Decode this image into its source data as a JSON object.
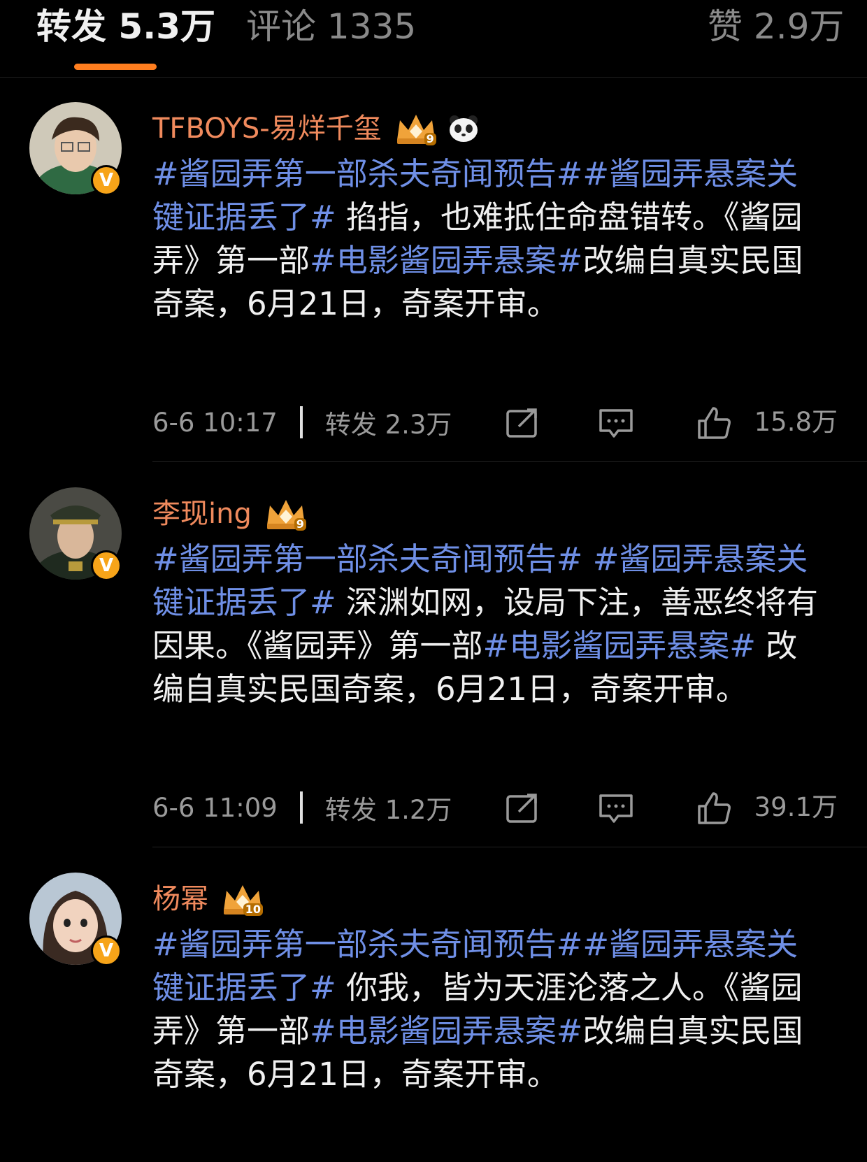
{
  "tabs": {
    "repost": "转发 5.3万",
    "comment": "评论 1335",
    "like": "赞 2.9万"
  },
  "colors": {
    "accent": "#ff7e1f",
    "username": "#f08a5d",
    "topic": "#6f8fe6",
    "badge": "#f7a419"
  },
  "posts": [
    {
      "user": "TFBOYS-易烊千玺",
      "level": "9",
      "verified_badge": "V",
      "topic1": "#酱园弄第一部杀夫奇闻预告##酱园弄悬案关键证据丢了#",
      "text1": " 掐指，也难抵住命盘错转。《酱园弄》第一部",
      "topic2": "#电影酱园弄悬案#",
      "text2": "改编自真实民国奇案，6月21日，奇案开审。",
      "time": "6-6 10:17",
      "repost": "转发 2.3万",
      "likes": "15.8万"
    },
    {
      "user": "李现ing",
      "level": "9",
      "verified_badge": "V",
      "topic1": "#酱园弄第一部杀夫奇闻预告# #酱园弄悬案关键证据丢了#",
      "text1": " 深渊如网，设局下注，善恶终将有因果。《酱园弄》第一部",
      "topic2": "#电影酱园弄悬案#",
      "text2": " 改编自真实民国奇案，6月21日，奇案开审。",
      "time": "6-6 11:09",
      "repost": "转发 1.2万",
      "likes": "39.1万"
    },
    {
      "user": "杨幂",
      "level": "10",
      "verified_badge": "V",
      "topic1": "#酱园弄第一部杀夫奇闻预告##酱园弄悬案关键证据丢了#",
      "text1": " 你我，皆为天涯沦落之人。《酱园弄》第一部",
      "topic2": "#电影酱园弄悬案#",
      "text2": "改编自真实民国奇案，6月21日，奇案开审。"
    }
  ]
}
